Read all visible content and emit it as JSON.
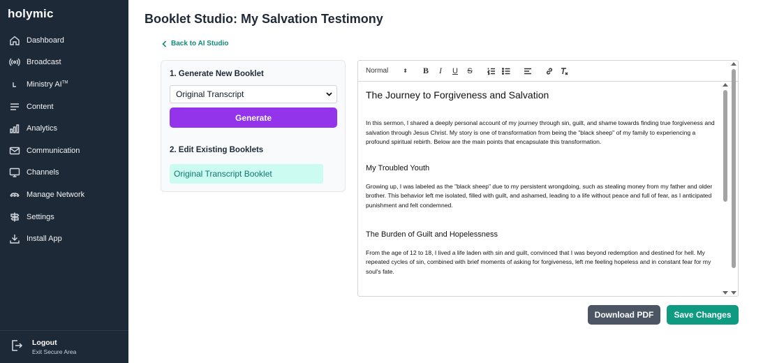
{
  "app": {
    "logo": "holymic"
  },
  "sidebar": {
    "items": [
      {
        "label": "Dashboard",
        "icon": "home-icon"
      },
      {
        "label": "Broadcast",
        "icon": "broadcast-icon"
      },
      {
        "label": "Ministry AI",
        "sup": "TM",
        "icon": "corner-arrow-icon"
      },
      {
        "label": "Content",
        "icon": "menu-lines-icon"
      },
      {
        "label": "Analytics",
        "icon": "bar-chart-icon"
      },
      {
        "label": "Communication",
        "icon": "mail-icon"
      },
      {
        "label": "Channels",
        "icon": "monitor-icon"
      },
      {
        "label": "Manage Network",
        "icon": "network-icon"
      },
      {
        "label": "Settings",
        "icon": "settings-signpost-icon"
      },
      {
        "label": "Install App",
        "icon": "download-icon"
      }
    ],
    "logout": {
      "title": "Logout",
      "subtitle": "Exit Secure Area"
    }
  },
  "page": {
    "title": "Booklet Studio: My Salvation Testimony",
    "back_link": "Back to AI Studio"
  },
  "panel": {
    "generate_heading": "1. Generate New Booklet",
    "select_value": "Original Transcript",
    "generate_button": "Generate",
    "edit_heading": "2. Edit Existing Booklets",
    "existing_booklets": [
      "Original Transcript Booklet"
    ]
  },
  "editor": {
    "toolbar": {
      "heading_select": "Normal"
    },
    "document": {
      "title": "The Journey to Forgiveness and Salvation",
      "intro": "In this sermon, I shared a deeply personal account of my journey through sin, guilt, and shame towards finding true forgiveness and salvation through Jesus Christ. My story is one of transformation from being the \"black sheep\" of my family to experiencing a profound spiritual rebirth. Below are the main points that encapsulate this transformation.",
      "sections": [
        {
          "heading": "My Troubled Youth",
          "body": "Growing up, I was labeled as the \"black sheep\" due to my persistent wrongdoing, such as stealing money from my father and older brother. This behavior left me isolated, filled with guilt, and ashamed, leading to a life without peace and full of fear, as I anticipated punishment and felt condemned."
        },
        {
          "heading": "The Burden of Guilt and Hopelessness",
          "body": "From the age of 12 to 18, I lived a life laden with sin and guilt, convinced that I was beyond redemption and destined for hell. My repeated cycles of sin, combined with brief moments of asking for forgiveness, left me feeling hopeless and in constant fear for my soul's fate."
        }
      ]
    }
  },
  "actions": {
    "download_pdf": "Download PDF",
    "save_changes": "Save Changes"
  }
}
